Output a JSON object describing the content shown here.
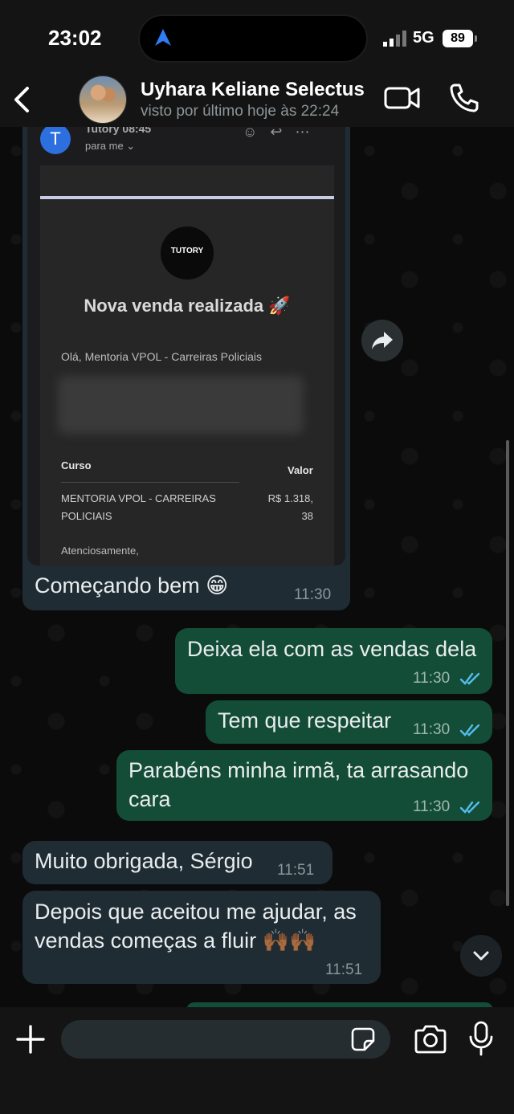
{
  "status_bar": {
    "time": "23:02",
    "network": "5G",
    "battery": "89"
  },
  "header": {
    "contact_name": "Uyhara Keliane Selectus",
    "last_seen": "visto por último hoje às 22:24"
  },
  "image_message": {
    "email": {
      "avatar_letter": "T",
      "sender": "Tutory",
      "sender_time": "08:45",
      "to": "para me ⌄",
      "logo_text": "TUTORY",
      "headline": "Nova venda realizada 🚀",
      "greeting": "Olá, Mentoria VPOL - Carreiras Policiais",
      "col_course": "Curso",
      "col_value": "Valor",
      "course_name": "MENTORIA VPOL - CARREIRAS POLICIAIS",
      "course_price": "R$ 1.318, 38",
      "signoff": "Atenciosamente,"
    },
    "caption": "Começando bem 😁",
    "time": "11:30"
  },
  "messages": [
    {
      "text": "Deixa ela com as vendas dela",
      "time": "11:30",
      "direction": "out"
    },
    {
      "text": "Tem que respeitar",
      "time": "11:30",
      "direction": "out"
    },
    {
      "text": "Parabéns minha irmã, ta arrasando cara",
      "time": "11:30",
      "direction": "out"
    },
    {
      "text": "Muito obrigada, Sérgio",
      "time": "11:51",
      "direction": "in"
    },
    {
      "text": "Depois que aceitou me ajudar, as vendas começas a fluir 🙌🏾🙌🏾",
      "time": "11:51",
      "direction": "in"
    }
  ],
  "input": {
    "placeholder": ""
  },
  "colors": {
    "outgoing_bubble": "#144d37",
    "incoming_bubble": "#1f2c33",
    "read_ticks": "#53bdeb"
  },
  "icons": [
    "back-arrow-icon",
    "video-call-icon",
    "phone-icon",
    "forward-icon",
    "chevron-down-icon",
    "plus-icon",
    "sticker-icon",
    "camera-icon",
    "microphone-icon"
  ]
}
